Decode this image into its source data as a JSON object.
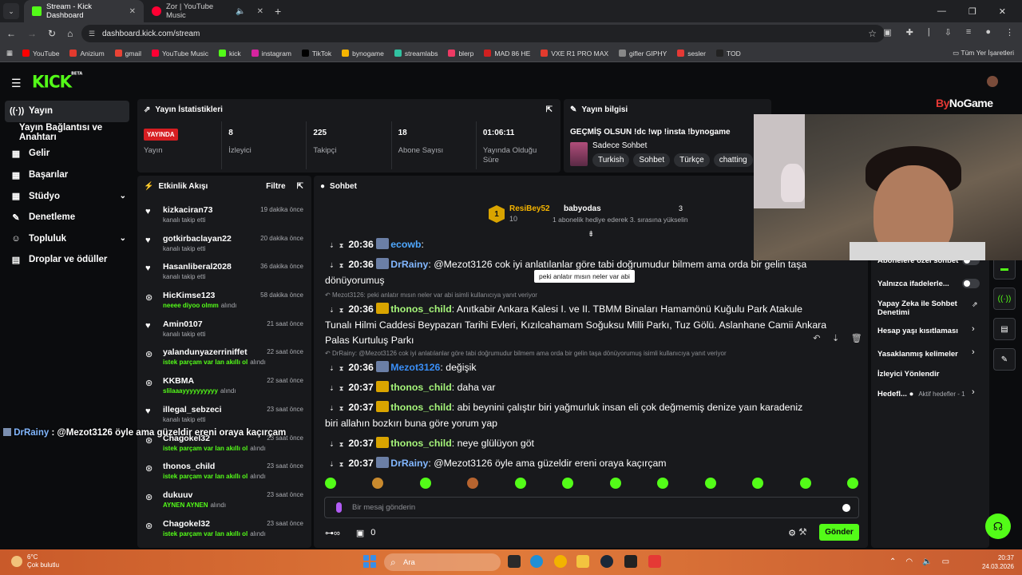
{
  "browser": {
    "tabs": [
      {
        "title": "Stream - Kick Dashboard",
        "color": "#53fc18"
      },
      {
        "title": "Zor | YouTube Music",
        "color": "#ff0033"
      }
    ],
    "url": "dashboard.kick.com/stream",
    "bookmarks": [
      {
        "label": "YouTube",
        "color": "#ff0000"
      },
      {
        "label": "Anizium",
        "color": "#e23a2e"
      },
      {
        "label": "gmail",
        "color": "#ea4335"
      },
      {
        "label": "YouTube Music",
        "color": "#ff0033"
      },
      {
        "label": "kick",
        "color": "#53fc18"
      },
      {
        "label": "instagram",
        "color": "#d6249f"
      },
      {
        "label": "TikTok",
        "color": "#000000"
      },
      {
        "label": "bynogame",
        "color": "#f5b400"
      },
      {
        "label": "streamlabs",
        "color": "#31c3a2"
      },
      {
        "label": "blerp",
        "color": "#ee3a64"
      },
      {
        "label": "MAD 86 HE",
        "color": "#d02020"
      },
      {
        "label": "VXE R1 PRO MAX",
        "color": "#e33b2e"
      },
      {
        "label": "gifler GIPHY",
        "color": "#888888"
      },
      {
        "label": "sesler",
        "color": "#e53935"
      },
      {
        "label": "TOD",
        "color": "#222222"
      }
    ],
    "bookmarks_right": "Tüm Yer İşaretleri"
  },
  "kick": {
    "logo": "KICK",
    "logo_sup": "BETA",
    "accent": "#53fc18",
    "nav": [
      {
        "label": "Yayın",
        "icon": "broadcast-icon",
        "glyph": "((·))",
        "active": true
      },
      {
        "label": "Yayın Bağlantısı ve Anahtarı",
        "sub": true
      },
      {
        "label": "Gelir",
        "icon": "revenue-icon",
        "glyph": "▦"
      },
      {
        "label": "Başarılar",
        "icon": "achievements-icon",
        "glyph": "▦"
      },
      {
        "label": "Stüdyo",
        "icon": "studio-icon",
        "glyph": "▦",
        "chevron": true
      },
      {
        "label": "Denetleme",
        "icon": "wrench-icon",
        "glyph": "✎"
      },
      {
        "label": "Topluluk",
        "icon": "community-icon",
        "glyph": "☺",
        "chevron": true
      },
      {
        "label": "Droplar ve ödüller",
        "icon": "drops-icon",
        "glyph": "▤"
      }
    ]
  },
  "stats": {
    "title": "Yayın İstatistikleri",
    "live_badge": "YAYINDA",
    "items": [
      {
        "value": "",
        "label": "Yayın"
      },
      {
        "value": "8",
        "label": "İzleyici"
      },
      {
        "value": "225",
        "label": "Takipçi"
      },
      {
        "value": "18",
        "label": "Abone Sayısı"
      },
      {
        "value": "01:06:11",
        "label": "Yayında Olduğu Süre"
      }
    ]
  },
  "stream_info": {
    "title": "Yayın bilgisi",
    "stream_title": "GEÇMİŞ OLSUN !dc !wp !insta !bynogame",
    "category": "Sadece Sohbet",
    "tags": [
      "Turkish",
      "Sohbet",
      "Türkçe",
      "chatting"
    ]
  },
  "activity": {
    "title": "Etkinlik Akışı",
    "filter": "Filtre",
    "items": [
      {
        "name": "kizkaciran73",
        "sub": "kanalı takip etti",
        "time": "19 dakika önce",
        "kind": "follow"
      },
      {
        "name": "gotkirbaclayan22",
        "sub": "kanalı takip etti",
        "time": "20 dakika önce",
        "kind": "follow"
      },
      {
        "name": "Hasanliberal2028",
        "sub": "kanalı takip etti",
        "time": "36 dakika önce",
        "kind": "follow"
      },
      {
        "name": "HicKimse123",
        "sub": "neeee diyoo olmm",
        "sub2": "alındı",
        "time": "58 dakika önce",
        "kind": "reward"
      },
      {
        "name": "Amin0107",
        "sub": "kanalı takip etti",
        "time": "21 saat önce",
        "kind": "follow"
      },
      {
        "name": "yalandunyazerriniffet",
        "sub": "istek parçam var lan akıllı ol",
        "sub2": "alındı",
        "time": "22 saat önce",
        "kind": "reward"
      },
      {
        "name": "KKBMA",
        "sub": "slilaaayyyyyyyyyy",
        "sub2": "alındı",
        "time": "22 saat önce",
        "kind": "reward"
      },
      {
        "name": "illegal_sebzeci",
        "sub": "kanalı takip etti",
        "time": "23 saat önce",
        "kind": "follow"
      },
      {
        "name": "Chagokel32",
        "sub": "istek parçam var lan akıllı ol",
        "sub2": "alındı",
        "time": "23 saat önce",
        "kind": "reward"
      },
      {
        "name": "thonos_child",
        "sub": "istek parçam var lan akıllı ol",
        "sub2": "alındı",
        "time": "23 saat önce",
        "kind": "reward"
      },
      {
        "name": "dukuuv",
        "sub": "AYNEN AYNEN",
        "sub2": "alındı",
        "time": "23 saat önce",
        "kind": "reward"
      },
      {
        "name": "Chagokel32",
        "sub": "istek parçam var lan akıllı ol",
        "sub2": "alındı",
        "time": "23 saat önce",
        "kind": "reward"
      }
    ]
  },
  "chat": {
    "title": "Sohbet",
    "pinned": {
      "rank": "1",
      "user": "ResiBey52",
      "count": "10",
      "gifter": "babyodas",
      "gift_count": "3",
      "gift_text": "1 abonelik hediye ederek 3. sırasına yükselin"
    },
    "messages": [
      {
        "time": "20:36",
        "user": "ecowb",
        "color": "#4fa8ff",
        "text": ""
      },
      {
        "time": "20:36",
        "user": "DrRainy",
        "color": "#82b7ff",
        "text": "@Mezot3126 cok iyi anlatılanlar göre tabi doğrumudur bilmem ama orda bir gelin taşa",
        "text2": "dönüyorumuş"
      },
      {
        "time": "20:36",
        "user": "thonos_child",
        "color": "#a6f57a",
        "text": "Anıtkabir Ankara Kalesi I. ve II. TBMM Binaları Hamamönü Kuğulu Park Atakule",
        "text2": "Tunalı Hilmi Caddesi Beypazarı Tarihi Evleri, Kızılcahamam Soğuksu Milli Parkı, Tuz Gölü. Aslanhane Camii Ankara",
        "text3": "Palas Kurtuluş Parkı",
        "reply": "Mezot3126: peki anlatır mısın neler var abi isimli kullanıcıya yanıt veriyor"
      },
      {
        "time": "20:36",
        "user": "Mezot3126",
        "color": "#3a8ef6",
        "text": "değişik",
        "reply": "DrRainy: @Mezot3126 cok iyi anlatılanlar göre tabi doğrumudur bilmem ama orda bir gelin taşa dönüyorumuş isimli kullanıcıya yanıt veriyor"
      },
      {
        "time": "20:37",
        "user": "thonos_child",
        "color": "#a6f57a",
        "text": "daha var"
      },
      {
        "time": "20:37",
        "user": "thonos_child",
        "color": "#a6f57a",
        "text": "abi beynini çalıştır biri yağmurluk insan eli çok değmemiş denize yaın karadeniz",
        "text2": "biri allahın bozkırı buna göre yorum yap"
      },
      {
        "time": "20:37",
        "user": "thonos_child",
        "color": "#a6f57a",
        "text": "neye glülüyon göt"
      },
      {
        "time": "20:37",
        "user": "DrRainy",
        "color": "#82b7ff",
        "text": "@Mezot3126 öyle ama güzeldir ereni oraya kaçırçam"
      }
    ],
    "tooltip": "peki anlatır mısın neler var abi",
    "input_placeholder": "Bir mesaj gönderin",
    "points": "0",
    "send": "Gönder"
  },
  "settings": {
    "rows": [
      {
        "label": "Abonelere özel sohbet",
        "control": "toggle"
      },
      {
        "label": "Yalnızca ifadelerle...",
        "control": "toggle"
      },
      {
        "label": "Yapay Zeka ile Sohbet Denetimi",
        "control": "link"
      },
      {
        "label": "Hesap yaşı kısıtlaması",
        "control": "chevron"
      },
      {
        "label": "Yasaklanmış kelimeler",
        "control": "chevron"
      },
      {
        "label": "İzleyici Yönlendir",
        "control": "none"
      },
      {
        "label": "Hedefl...",
        "extra": "Aktif hedefler - 1",
        "control": "chevron"
      }
    ]
  },
  "overlay": {
    "user": "DrRainy",
    "text": " : @Mezot3126 öyle ama güzeldir ereni oraya kaçırçam"
  },
  "watermark": {
    "part1": "By",
    "part2": "NoGame"
  },
  "taskbar": {
    "temp": "6°C",
    "weather": "Çok bulutlu",
    "search": "Ara",
    "time": "20:37",
    "date": "24.03.2026"
  }
}
